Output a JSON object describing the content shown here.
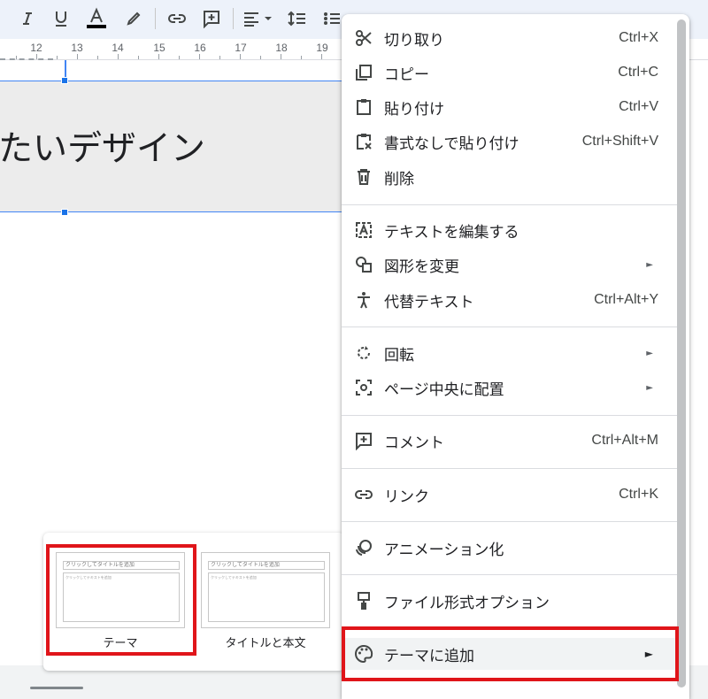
{
  "ruler": {
    "numbers": [
      "12",
      "13",
      "14",
      "15",
      "16",
      "17",
      "18",
      "19"
    ]
  },
  "slide": {
    "title_text": "たいデザイン"
  },
  "layouts": [
    {
      "label": "テーマ",
      "thumb_title": "クリックしてタイトルを追加",
      "thumb_body": "クリックしてテキストを追加"
    },
    {
      "label": "タイトルと本文",
      "thumb_title": "クリックしてタイトルを追加",
      "thumb_body": "クリックしてテキストを追加"
    }
  ],
  "menu": {
    "cut": {
      "label": "切り取り",
      "shortcut": "Ctrl+X",
      "icon": "scissors-icon"
    },
    "copy": {
      "label": "コピー",
      "shortcut": "Ctrl+C",
      "icon": "copy-icon"
    },
    "paste": {
      "label": "貼り付け",
      "shortcut": "Ctrl+V",
      "icon": "clipboard-icon"
    },
    "paste_plain": {
      "label": "書式なしで貼り付け",
      "shortcut": "Ctrl+Shift+V",
      "icon": "paste-no-format-icon"
    },
    "delete": {
      "label": "削除",
      "icon": "trash-icon"
    },
    "edit_text": {
      "label": "テキストを編集する",
      "icon": "text-box-icon"
    },
    "change_shape": {
      "label": "図形を変更",
      "icon": "shapes-icon"
    },
    "alt_text": {
      "label": "代替テキスト",
      "shortcut": "Ctrl+Alt+Y",
      "icon": "accessibility-icon"
    },
    "rotate": {
      "label": "回転",
      "icon": "rotate-icon"
    },
    "center_page": {
      "label": "ページ中央に配置",
      "icon": "center-focus-icon"
    },
    "comment": {
      "label": "コメント",
      "shortcut": "Ctrl+Alt+M",
      "icon": "add-comment-icon"
    },
    "link": {
      "label": "リンク",
      "shortcut": "Ctrl+K",
      "icon": "link-icon"
    },
    "animate": {
      "label": "アニメーション化",
      "icon": "animation-icon"
    },
    "format_options": {
      "label": "ファイル形式オプション",
      "icon": "format-paint-icon"
    },
    "add_to_theme": {
      "label": "テーマに追加",
      "icon": "palette-icon"
    },
    "submenu_arrow": "►"
  },
  "colors": {
    "highlight_red": "#e0151a",
    "selection_blue": "#4285f4",
    "toolbar_bg": "#edf2fa"
  }
}
